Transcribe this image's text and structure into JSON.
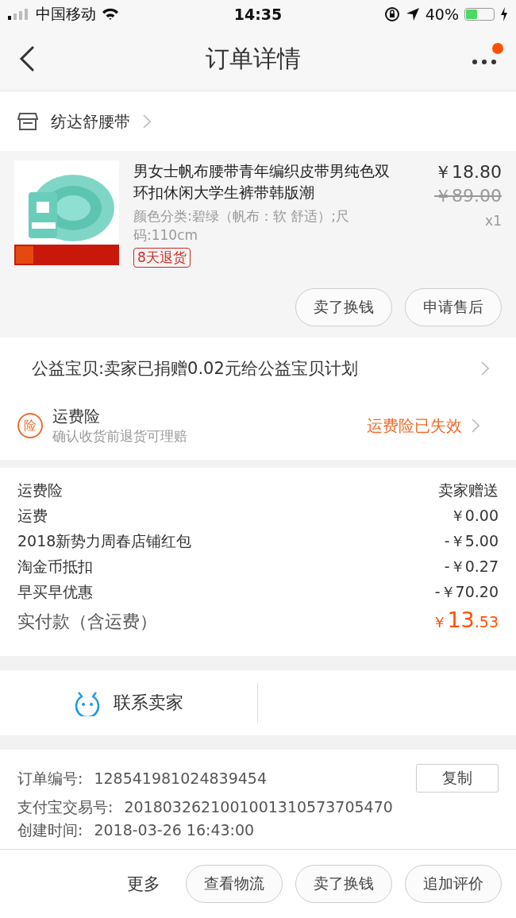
{
  "status_bar": {
    "carrier": "中国移动",
    "time": "14:35",
    "battery_text": "40%"
  },
  "nav": {
    "title": "订单详情",
    "has_notification": true
  },
  "shop": {
    "name": "纺达舒腰带"
  },
  "product": {
    "title": "男女士帆布腰带青年编织皮带男纯色双环扣休闲大学生裤带韩版潮",
    "sku": "颜色分类:碧绿（帆布：软 舒适）;尺码:110cm",
    "tag": "8天退货",
    "price": "￥18.80",
    "original_price": "￥89.00",
    "quantity": "x1",
    "buttons": [
      "卖了换钱",
      "申请售后"
    ]
  },
  "charity": {
    "text": "公益宝贝:卖家已捐赠0.02元给公益宝贝计划"
  },
  "insurance": {
    "icon_char": "险",
    "title": "运费险",
    "subtitle": "确认收货前退货可理赔",
    "status": "运费险已失效"
  },
  "fees": [
    {
      "label": "运费险",
      "value": "卖家赠送"
    },
    {
      "label": "运费",
      "value": "￥0.00"
    },
    {
      "label": "2018新势力周春店铺红包",
      "value": "-￥5.00"
    },
    {
      "label": "淘金币抵扣",
      "value": "-￥0.27"
    },
    {
      "label": "早买早优惠",
      "value": "-￥70.20"
    }
  ],
  "total": {
    "label": "实付款（含运费）",
    "currency": "￥",
    "integer": "13",
    "decimal": ".53"
  },
  "contact": {
    "label": "联系卖家"
  },
  "order_info": [
    {
      "label": "订单编号:",
      "value": "128541981024839454",
      "copy_button": "复制"
    },
    {
      "label": "支付宝交易号:",
      "value": "2018032621001001310573705470"
    },
    {
      "label": "创建时间:",
      "value": "2018-03-26 16:43:00"
    }
  ],
  "bottom_bar": {
    "more": "更多",
    "buttons": [
      "查看物流",
      "卖了换钱",
      "追加评价"
    ]
  }
}
